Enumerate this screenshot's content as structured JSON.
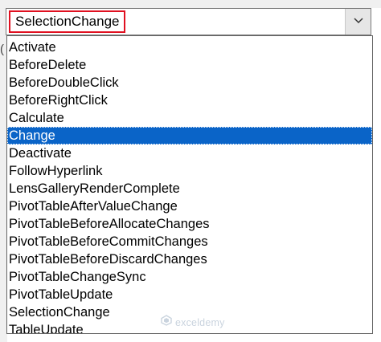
{
  "combo": {
    "value": "SelectionChange",
    "dropdown_icon": "chevron-down-icon"
  },
  "hint_char": "(",
  "list": {
    "items": [
      "Activate",
      "BeforeDelete",
      "BeforeDoubleClick",
      "BeforeRightClick",
      "Calculate",
      "Change",
      "Deactivate",
      "FollowHyperlink",
      "LensGalleryRenderComplete",
      "PivotTableAfterValueChange",
      "PivotTableBeforeAllocateChanges",
      "PivotTableBeforeCommitChanges",
      "PivotTableBeforeDiscardChanges",
      "PivotTableChangeSync",
      "PivotTableUpdate",
      "SelectionChange",
      "TableUpdate"
    ],
    "selected": "Change"
  },
  "watermark": {
    "text": "exceldemy",
    "icon": "exceldemy-logo-icon"
  },
  "colors": {
    "highlight_border": "#e01020",
    "selection_bg": "#0a64c8"
  }
}
